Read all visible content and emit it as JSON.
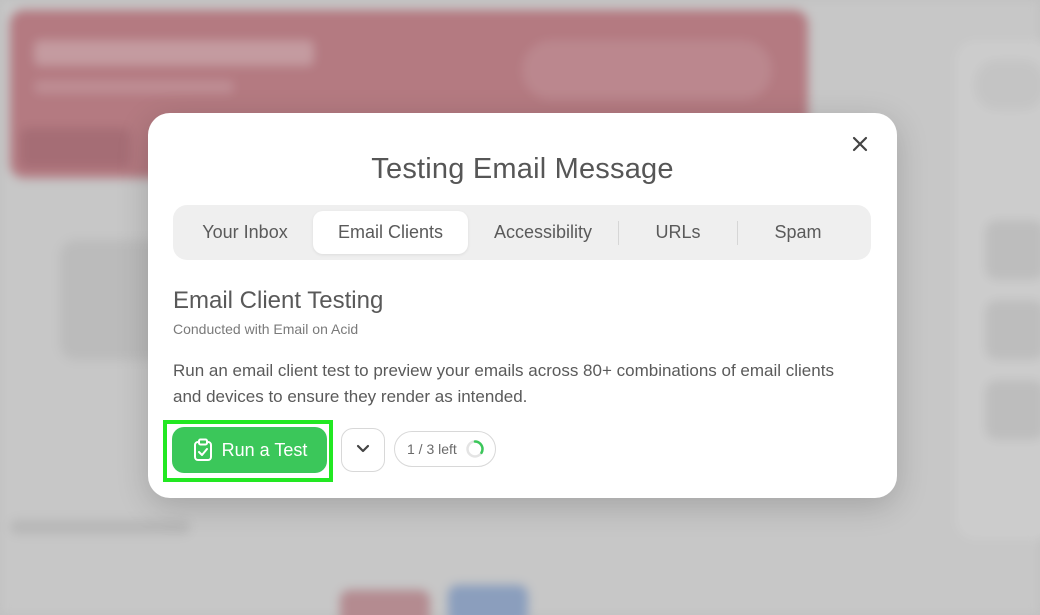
{
  "modal": {
    "title": "Testing Email Message",
    "close_icon": "close-icon"
  },
  "tabs": [
    {
      "label": "Your Inbox",
      "active": false
    },
    {
      "label": "Email Clients",
      "active": true
    },
    {
      "label": "Accessibility",
      "active": false
    },
    {
      "label": "URLs",
      "active": false
    },
    {
      "label": "Spam",
      "active": false
    }
  ],
  "section": {
    "title": "Email Client Testing",
    "subtitle": "Conducted with Email on Acid",
    "description": "Run an email client test to preview your emails across 80+ combinations of email clients and devices to ensure they render as intended."
  },
  "actions": {
    "run_label": "Run a Test",
    "run_icon": "clipboard-check-icon",
    "dropdown_icon": "chevron-down-icon",
    "quota_text": "1 / 3 left",
    "quota_used_fraction": 0.333,
    "quota_ring_icon": "progress-ring-icon"
  },
  "colors": {
    "accent_green": "#3bc75a",
    "highlight": "#22e822",
    "background_banner": "#c9707b"
  }
}
